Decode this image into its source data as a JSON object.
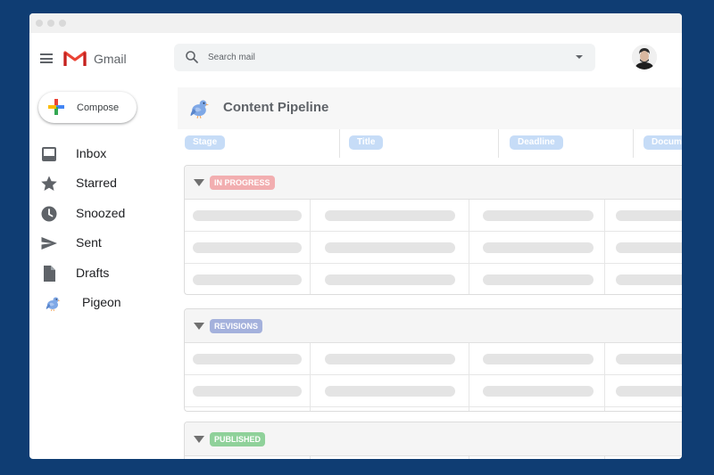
{
  "app": {
    "name": "Gmail"
  },
  "search": {
    "placeholder": "Search mail"
  },
  "compose": {
    "label": "Compose"
  },
  "nav": {
    "items": [
      {
        "label": "Inbox",
        "icon": "inbox-icon"
      },
      {
        "label": "Starred",
        "icon": "star-icon"
      },
      {
        "label": "Snoozed",
        "icon": "clock-icon"
      },
      {
        "label": "Sent",
        "icon": "send-icon"
      },
      {
        "label": "Drafts",
        "icon": "draft-icon"
      },
      {
        "label": "Pigeon",
        "icon": "pigeon-bird-icon"
      }
    ]
  },
  "pipeline": {
    "title": "Content Pipeline",
    "columns": [
      "Stage",
      "Title",
      "Deadline",
      "Docume"
    ],
    "groups": [
      {
        "label": "IN PROGRESS",
        "color": "#f2aeb0",
        "rows": 3
      },
      {
        "label": "REVISIONS",
        "color": "#a4b1dc",
        "rows": 2
      },
      {
        "label": "PUBLISHED",
        "color": "#8fd19a",
        "rows": 0
      }
    ]
  },
  "colors": {
    "background": "#0f3d73",
    "chip": "#c6dcf7",
    "gmail_red": "#ea4335"
  }
}
